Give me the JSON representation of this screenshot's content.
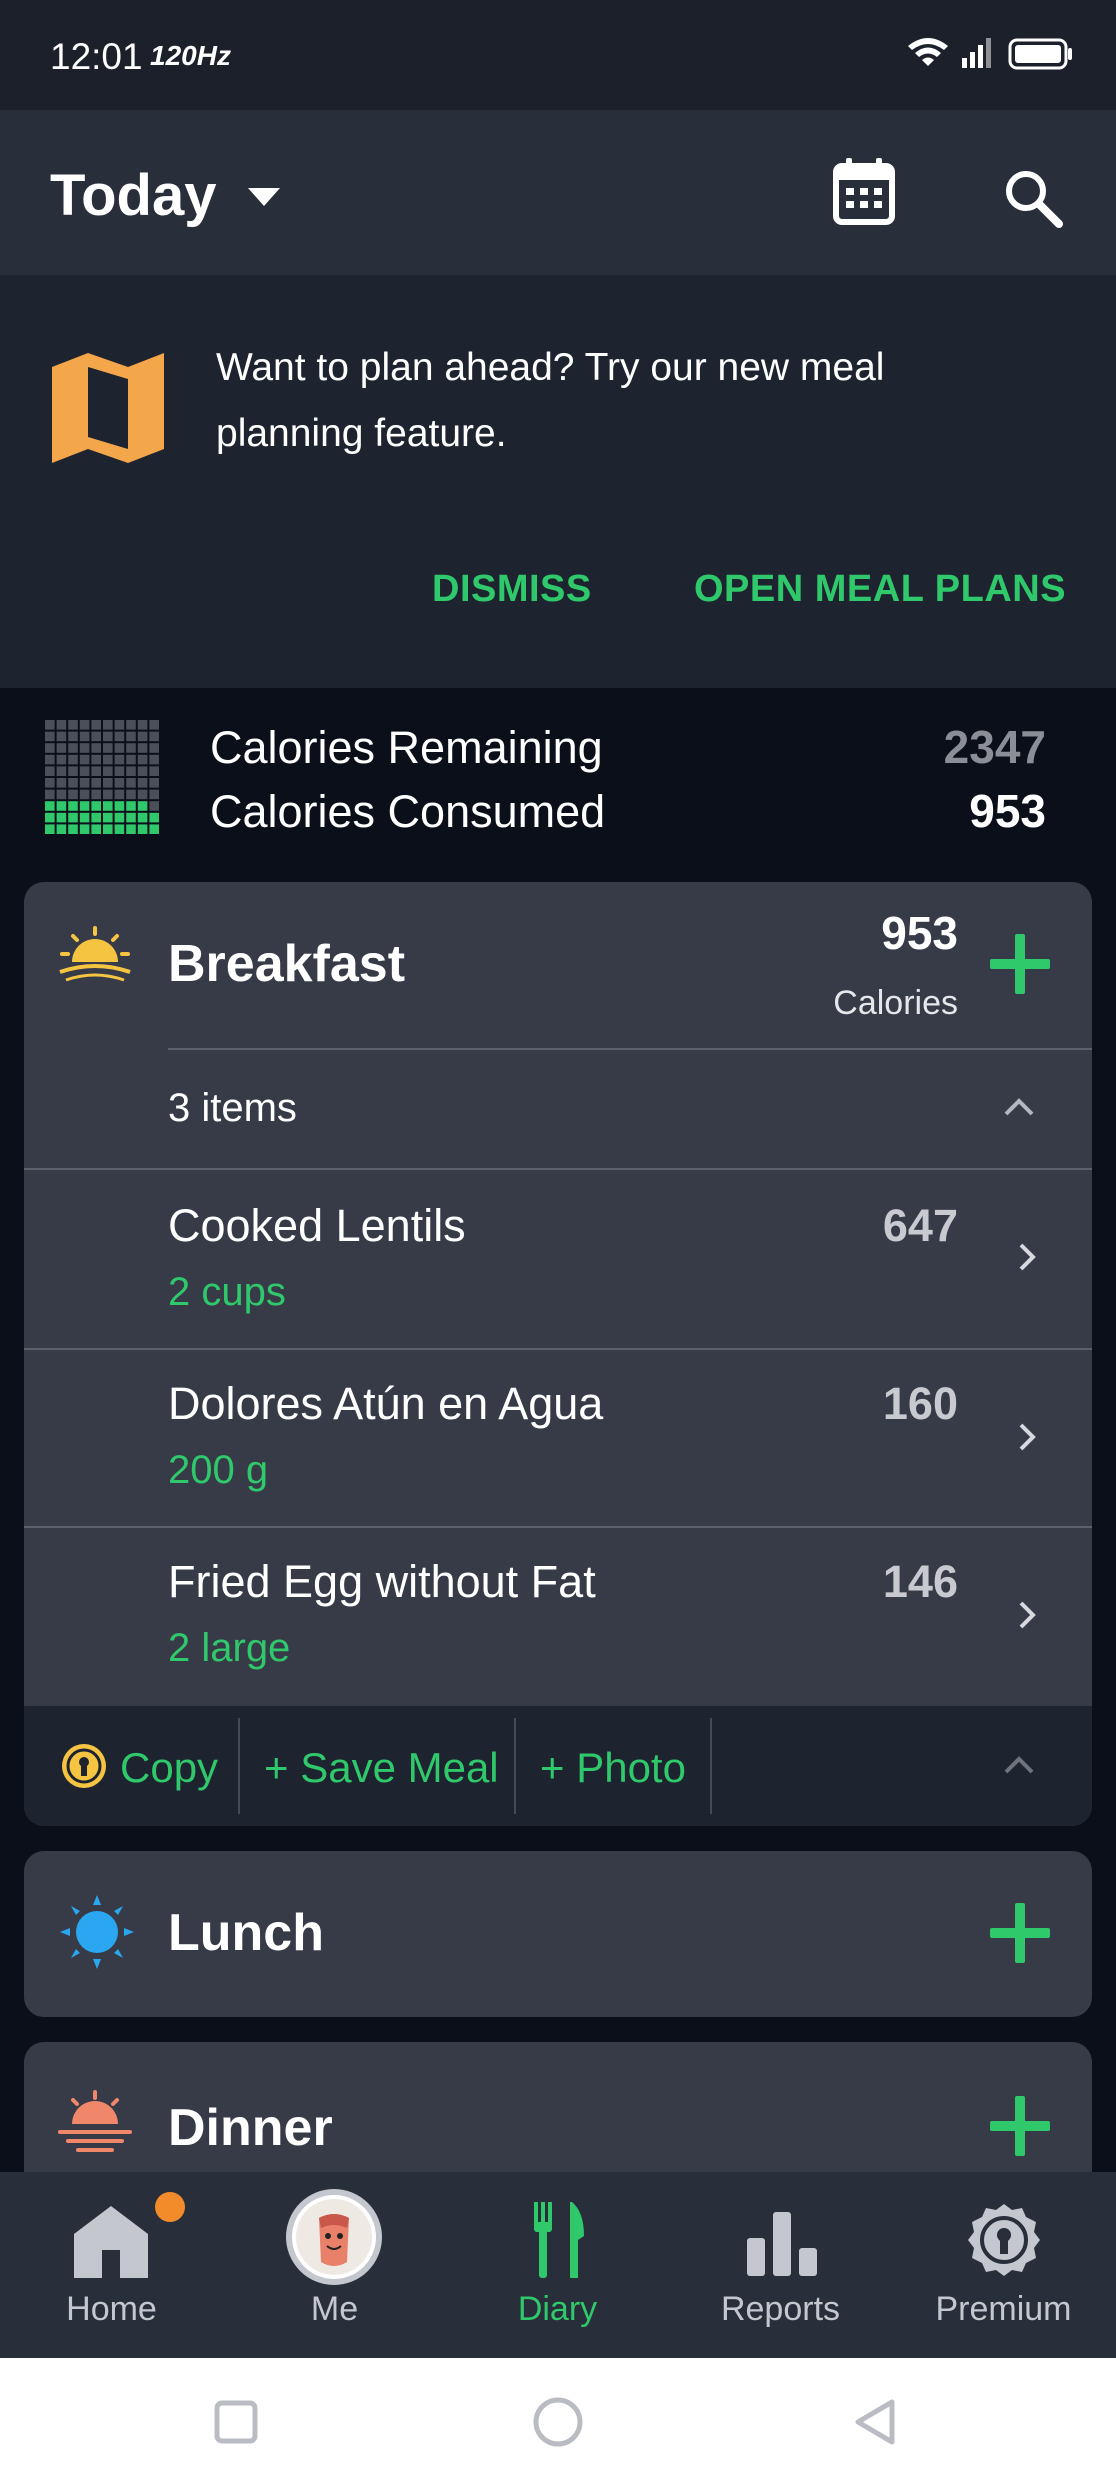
{
  "status_bar": {
    "time": "12:01",
    "refresh_rate": "120Hz"
  },
  "app_bar": {
    "title": "Today"
  },
  "banner": {
    "text": "Want to plan ahead? Try our new meal planning feature.",
    "dismiss_label": "DISMISS",
    "open_label": "OPEN MEAL PLANS"
  },
  "summary": {
    "remaining_label": "Calories Remaining",
    "remaining_value": "2347",
    "consumed_label": "Calories Consumed",
    "consumed_value": "953",
    "consumed_fraction": 0.289
  },
  "breakfast": {
    "title": "Breakfast",
    "calories": "953",
    "calories_label": "Calories",
    "items_count": "3 items",
    "items": [
      {
        "name": "Cooked Lentils",
        "portion": "2 cups",
        "calories": "647"
      },
      {
        "name": "Dolores Atún en Agua",
        "portion": "200 g",
        "calories": "160"
      },
      {
        "name": "Fried Egg without Fat",
        "portion": "2 large",
        "calories": "146"
      }
    ],
    "footer": {
      "copy": "Copy",
      "save_meal": "+ Save Meal",
      "photo": "+ Photo"
    }
  },
  "lunch": {
    "title": "Lunch"
  },
  "dinner": {
    "title": "Dinner"
  },
  "bottom_nav": {
    "home": "Home",
    "me": "Me",
    "diary": "Diary",
    "reports": "Reports",
    "premium": "Premium"
  },
  "colors": {
    "accent_green": "#2fc86a",
    "card_bg": "#373b48",
    "notification_dot": "#f28c2a",
    "sun_yellow": "#f5c542",
    "sun_blue": "#2aa7f0",
    "sunset_orange": "#f0876a"
  },
  "icons": [
    "caret-down-icon",
    "calendar-icon",
    "search-icon",
    "map-icon",
    "calorie-grid-icon",
    "sunrise-icon",
    "sun-icon",
    "sunset-icon",
    "plus-icon",
    "chevron-up-icon",
    "chevron-right-icon",
    "premium-badge-icon",
    "home-icon",
    "avatar",
    "diary-fork-knife-icon",
    "reports-bars-icon"
  ]
}
